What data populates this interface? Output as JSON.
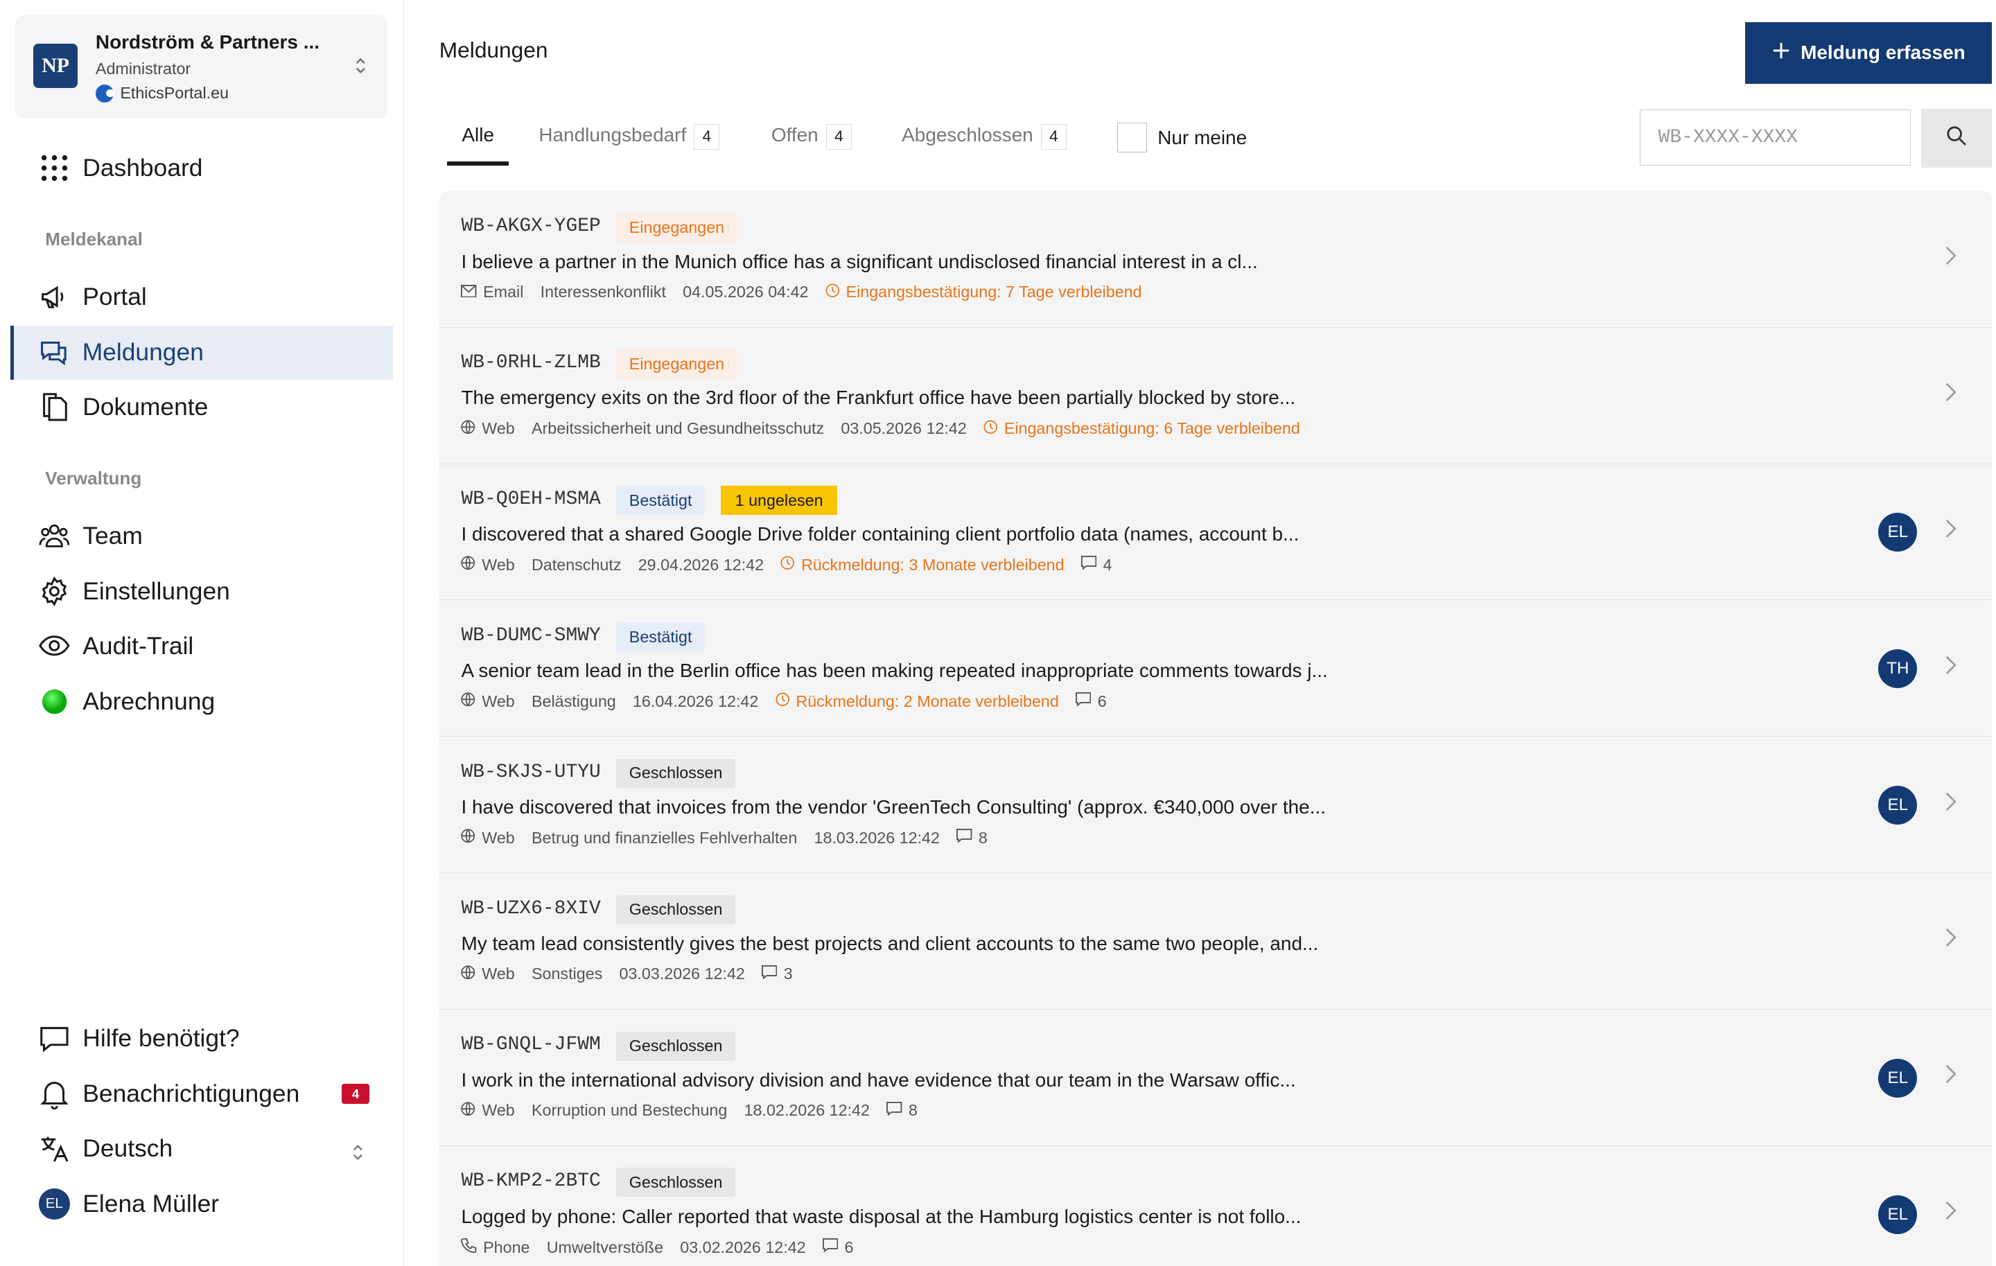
{
  "org": {
    "initials": "NP",
    "name": "Nordström & Partners ...",
    "role": "Administrator",
    "portal": "EthicsPortal.eu"
  },
  "nav": {
    "dashboard": "Dashboard",
    "section_meldekanal": "Meldekanal",
    "portal": "Portal",
    "meldungen": "Meldungen",
    "dokumente": "Dokumente",
    "section_verwaltung": "Verwaltung",
    "team": "Team",
    "einstellungen": "Einstellungen",
    "audit": "Audit-Trail",
    "abrechnung": "Abrechnung"
  },
  "footer": {
    "help": "Hilfe benötigt?",
    "notifications": "Benachrichtigungen",
    "notifications_count": "4",
    "language": "Deutsch",
    "user_initials": "EL",
    "user_name": "Elena Müller"
  },
  "header": {
    "title": "Meldungen",
    "add_button": "Meldung erfassen"
  },
  "tabs": [
    {
      "label": "Alle",
      "count": ""
    },
    {
      "label": "Handlungsbedarf",
      "count": "4"
    },
    {
      "label": "Offen",
      "count": "4"
    },
    {
      "label": "Abgeschlossen",
      "count": "4"
    }
  ],
  "filter": {
    "only_mine": "Nur meine"
  },
  "search": {
    "placeholder": "WB-XXXX-XXXX"
  },
  "colors": {
    "primary": "#143a73",
    "warning": "#e8751a",
    "unread": "#f9c400",
    "badge": "#c8102e",
    "billing_status": "#1ec41e"
  },
  "reports": [
    {
      "id": "WB-AKGX-YGEP",
      "status": "Eingegangen",
      "unread": "",
      "title": "I believe a partner in the Munich office has a significant undisclosed financial interest in a cl...",
      "channel": "Email",
      "channel_icon": "mail-icon",
      "category": "Interessenkonflikt",
      "date": "04.05.2026 04:42",
      "deadline": "Eingangsbestätigung: 7 Tage verbleibend",
      "comments": "",
      "assignee": ""
    },
    {
      "id": "WB-0RHL-ZLMB",
      "status": "Eingegangen",
      "unread": "",
      "title": "The emergency exits on the 3rd floor of the Frankfurt office have been partially blocked by store...",
      "channel": "Web",
      "channel_icon": "globe-icon",
      "category": "Arbeitssicherheit und Gesundheitsschutz",
      "date": "03.05.2026 12:42",
      "deadline": "Eingangsbestätigung: 6 Tage verbleibend",
      "comments": "",
      "assignee": ""
    },
    {
      "id": "WB-Q0EH-MSMA",
      "status": "Bestätigt",
      "unread": "1 ungelesen",
      "title": "I discovered that a shared Google Drive folder containing client portfolio data (names, account b...",
      "channel": "Web",
      "channel_icon": "globe-icon",
      "category": "Datenschutz",
      "date": "29.04.2026 12:42",
      "deadline": "Rückmeldung: 3 Monate verbleibend",
      "comments": "4",
      "assignee": "EL"
    },
    {
      "id": "WB-DUMC-SMWY",
      "status": "Bestätigt",
      "unread": "",
      "title": "A senior team lead in the Berlin office has been making repeated inappropriate comments towards j...",
      "channel": "Web",
      "channel_icon": "globe-icon",
      "category": "Belästigung",
      "date": "16.04.2026 12:42",
      "deadline": "Rückmeldung: 2 Monate verbleibend",
      "comments": "6",
      "assignee": "TH"
    },
    {
      "id": "WB-SKJS-UTYU",
      "status": "Geschlossen",
      "unread": "",
      "title": "I have discovered that invoices from the vendor 'GreenTech Consulting' (approx. €340,000 over the...",
      "channel": "Web",
      "channel_icon": "globe-icon",
      "category": "Betrug und finanzielles Fehlverhalten",
      "date": "18.03.2026 12:42",
      "deadline": "",
      "comments": "8",
      "assignee": "EL"
    },
    {
      "id": "WB-UZX6-8XIV",
      "status": "Geschlossen",
      "unread": "",
      "title": "My team lead consistently gives the best projects and client accounts to the same two people, and...",
      "channel": "Web",
      "channel_icon": "globe-icon",
      "category": "Sonstiges",
      "date": "03.03.2026 12:42",
      "deadline": "",
      "comments": "3",
      "assignee": ""
    },
    {
      "id": "WB-GNQL-JFWM",
      "status": "Geschlossen",
      "unread": "",
      "title": "I work in the international advisory division and have evidence that our team in the Warsaw offic...",
      "channel": "Web",
      "channel_icon": "globe-icon",
      "category": "Korruption und Bestechung",
      "date": "18.02.2026 12:42",
      "deadline": "",
      "comments": "8",
      "assignee": "EL"
    },
    {
      "id": "WB-KMP2-2BTC",
      "status": "Geschlossen",
      "unread": "",
      "title": "Logged by phone: Caller reported that waste disposal at the Hamburg logistics center is not follo...",
      "channel": "Phone",
      "channel_icon": "phone-icon",
      "category": "Umweltverstöße",
      "date": "03.02.2026 12:42",
      "deadline": "",
      "comments": "6",
      "assignee": "EL"
    }
  ]
}
